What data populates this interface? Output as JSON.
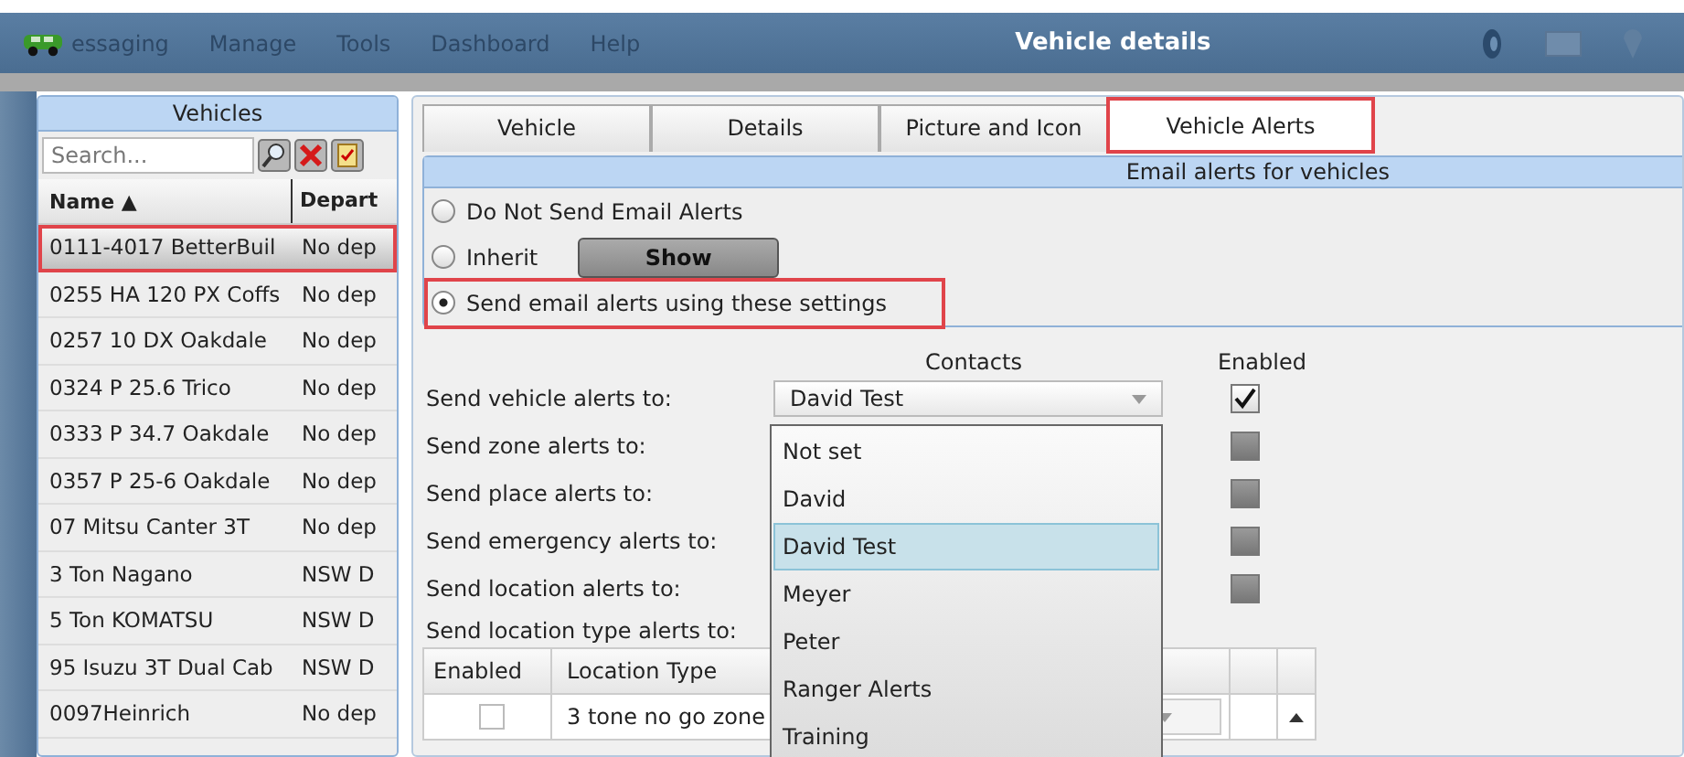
{
  "menu": [
    {
      "label": "essaging"
    },
    {
      "label": "Manage"
    },
    {
      "label": "Tools"
    },
    {
      "label": "Dashboard"
    },
    {
      "label": "Help"
    }
  ],
  "window": {
    "title": "Vehicle details"
  },
  "sidebar": {
    "title": "Vehicles",
    "search": {
      "placeholder": "Search..."
    },
    "columns": [
      {
        "label": "Name ▲"
      },
      {
        "label": "Depart"
      }
    ],
    "rows": [
      {
        "name": "0111-4017 BetterBuil",
        "department": "No dep",
        "selected": true,
        "highlighted": true
      },
      {
        "name": "0255 HA 120 PX Coffs",
        "department": "No dep",
        "selected": false,
        "highlighted": false
      },
      {
        "name": "0257 10 DX Oakdale",
        "department": "No dep",
        "selected": false,
        "highlighted": false
      },
      {
        "name": "0324 P 25.6 Trico",
        "department": "No dep",
        "selected": false,
        "highlighted": false
      },
      {
        "name": "0333 P 34.7 Oakdale",
        "department": "No dep",
        "selected": false,
        "highlighted": false
      },
      {
        "name": "0357 P 25-6 Oakdale",
        "department": "No dep",
        "selected": false,
        "highlighted": false
      },
      {
        "name": "07 Mitsu Canter 3T",
        "department": "No dep",
        "selected": false,
        "highlighted": false
      },
      {
        "name": "3 Ton Nagano",
        "department": "NSW D",
        "selected": false,
        "highlighted": false
      },
      {
        "name": "5 Ton KOMATSU",
        "department": "NSW D",
        "selected": false,
        "highlighted": false
      },
      {
        "name": "95 Isuzu 3T Dual Cab",
        "department": "NSW D",
        "selected": false,
        "highlighted": false
      },
      {
        "name": "0097Heinrich",
        "department": "No dep",
        "selected": false,
        "highlighted": false
      }
    ]
  },
  "tabs": [
    {
      "label": "Vehicle",
      "selected": false,
      "highlighted": false
    },
    {
      "label": "Details",
      "selected": false,
      "highlighted": false
    },
    {
      "label": "Picture and Icon",
      "selected": false,
      "highlighted": false
    },
    {
      "label": "Vehicle Alerts",
      "selected": true,
      "highlighted": true
    }
  ],
  "alerts": {
    "title": "Email alerts for vehicles",
    "options": [
      {
        "label": "Do Not Send Email Alerts",
        "selected": false,
        "highlighted": false
      },
      {
        "label": "Inherit",
        "selected": false,
        "highlighted": false,
        "button": "Show"
      },
      {
        "label": "Send email alerts using these settings",
        "selected": true,
        "highlighted": true
      }
    ],
    "contacts_heading": "Contacts",
    "enabled_heading": "Enabled",
    "rows": [
      {
        "label": "Send vehicle alerts to:",
        "contact": "David Test",
        "enabled": true
      },
      {
        "label": "Send zone alerts to:",
        "enabled": false
      },
      {
        "label": "Send place alerts to:",
        "enabled": false
      },
      {
        "label": "Send emergency alerts to:",
        "enabled": false
      },
      {
        "label": "Send location alerts to:",
        "enabled": false
      }
    ],
    "dropdown": {
      "options": [
        {
          "label": "Not set",
          "selected": false
        },
        {
          "label": "David",
          "selected": false
        },
        {
          "label": "David Test",
          "selected": true
        },
        {
          "label": "Meyer",
          "selected": false
        },
        {
          "label": "Peter",
          "selected": false
        },
        {
          "label": "Ranger Alerts",
          "selected": false
        },
        {
          "label": "Training",
          "selected": false
        }
      ]
    },
    "location_type_label": "Send location type alerts to:",
    "table": {
      "columns": [
        {
          "label": "Enabled"
        },
        {
          "label": "Location Type"
        }
      ],
      "rows": [
        {
          "enabled": false,
          "location_type": "3 tone no go zone"
        }
      ]
    }
  }
}
